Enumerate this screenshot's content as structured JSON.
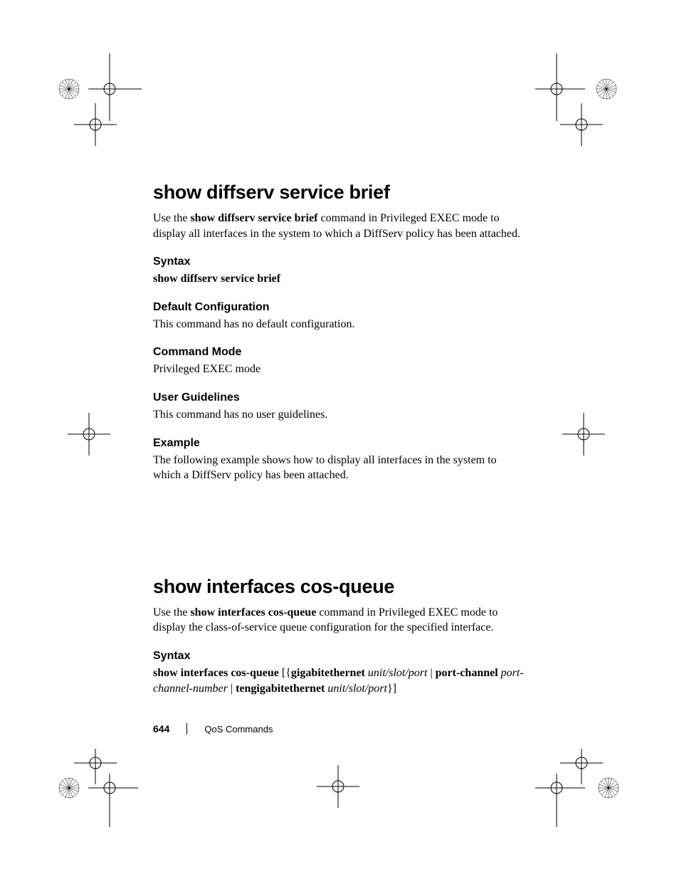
{
  "section1": {
    "heading": "show diffserv service brief",
    "intro_pre": "Use the ",
    "intro_bold": "show diffserv service brief",
    "intro_post": " command in Privileged EXEC mode to display all interfaces in the system to which a DiffServ policy has been attached.",
    "syntax_h": "Syntax",
    "syntax_line": "show diffserv service brief",
    "defcfg_h": "Default Configuration",
    "defcfg_p": "This command has no default configuration.",
    "cmdmode_h": "Command Mode",
    "cmdmode_p": "Privileged EXEC mode",
    "ug_h": "User Guidelines",
    "ug_p": "This command has no user guidelines.",
    "ex_h": "Example",
    "ex_p": "The following example shows how to display all interfaces in the system to which a DiffServ policy has been attached."
  },
  "section2": {
    "heading": "show interfaces cos-queue",
    "intro_pre": "Use the ",
    "intro_bold": "show interfaces cos-queue",
    "intro_post": " command in Privileged EXEC mode to display the class-of-service queue configuration for the specified interface.",
    "syntax_h": "Syntax",
    "syn": {
      "b1": "show interfaces cos-queue",
      "t1": " [{",
      "b2": "gigabitethernet",
      "sp1": " ",
      "i1": "unit/slot/port",
      "t2": " | ",
      "b3": "port-channel",
      "sp2": " ",
      "i2": "port-channel-number",
      "t3": " | ",
      "b4": "tengigabitethernet",
      "sp3": " ",
      "i3": "unit/slot/port",
      "t4": "}]"
    }
  },
  "footer": {
    "page": "644",
    "chapter": "QoS Commands"
  }
}
